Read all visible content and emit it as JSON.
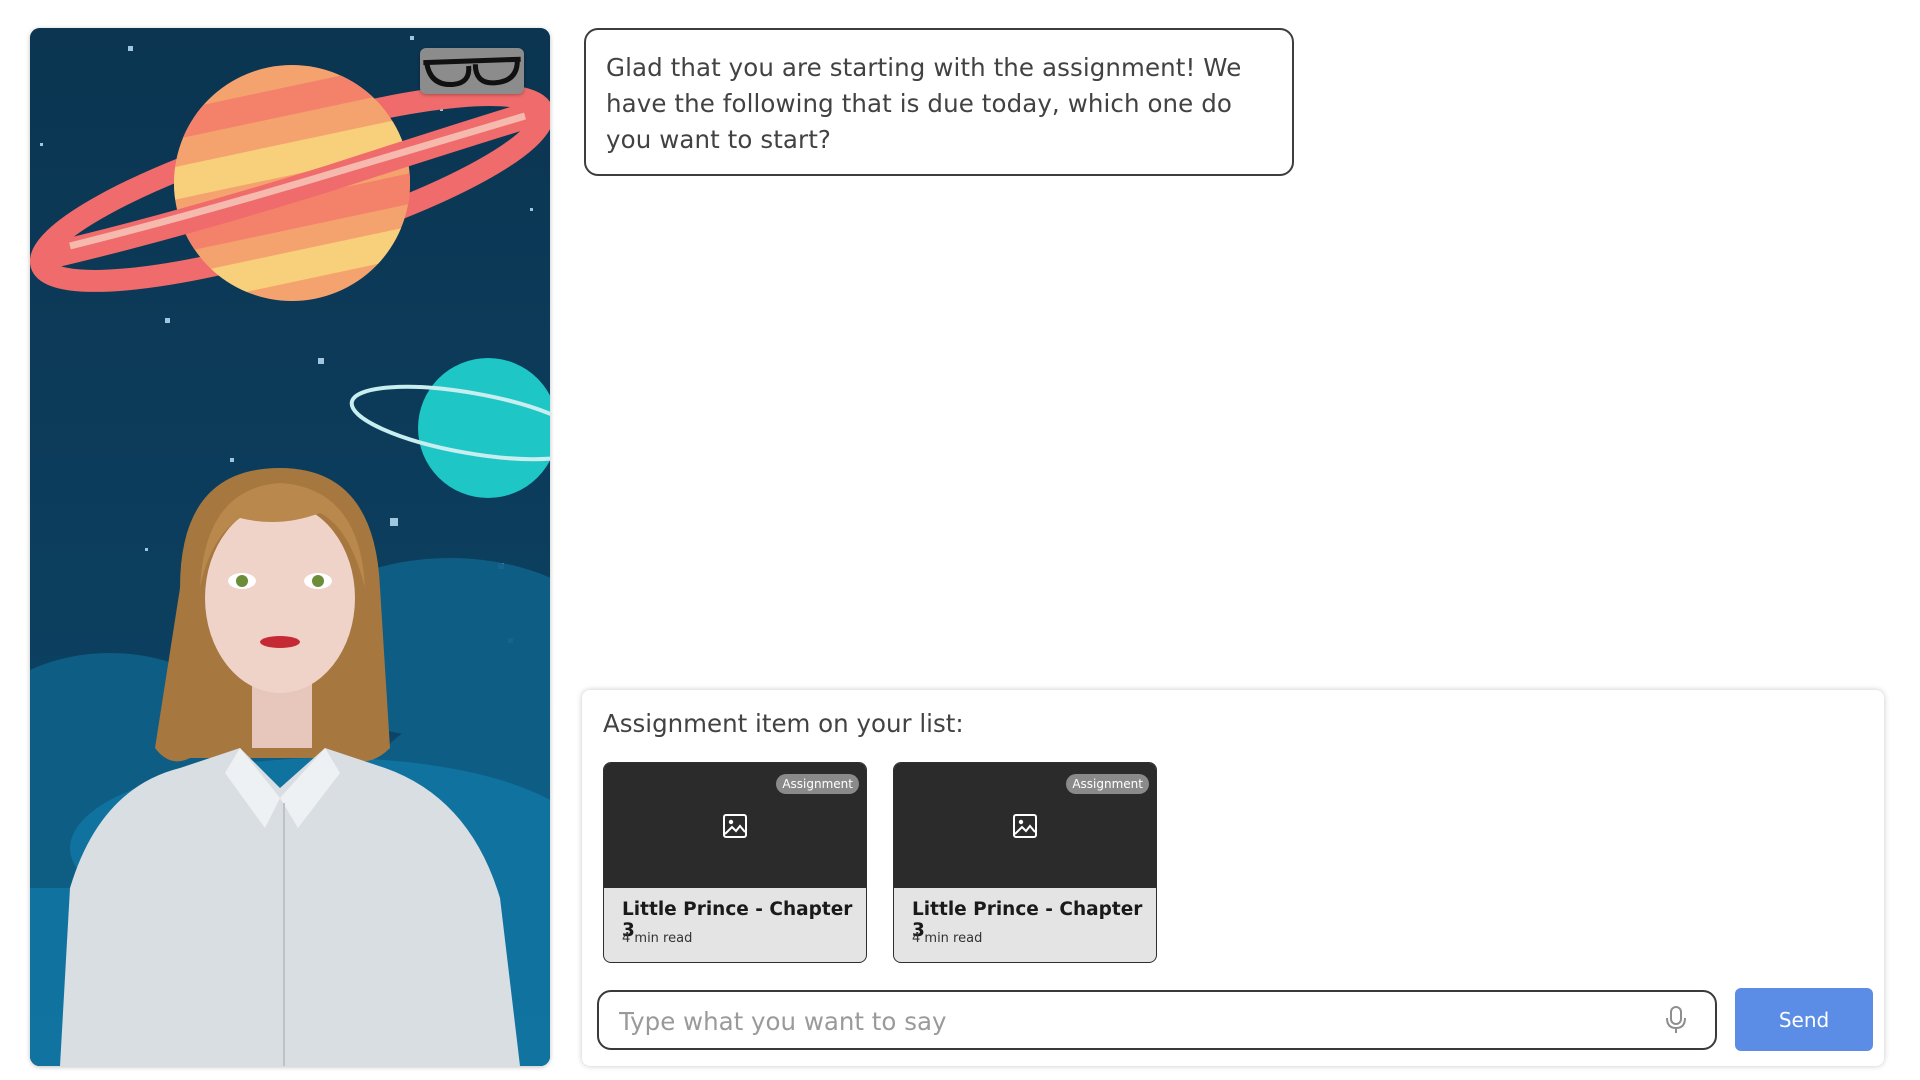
{
  "assistant": {
    "message": "Glad that you are starting with the assignment! We have the following that is due today, which one do you want to start?"
  },
  "avatar": {
    "toggle_icon": "glasses-icon"
  },
  "assignments": {
    "heading": "Assignment item on your list:",
    "items": [
      {
        "badge": "Assignment",
        "title": "Little Prince - Chapter 3",
        "meta": "4 min read",
        "thumb_icon": "image-icon"
      },
      {
        "badge": "Assignment",
        "title": "Little Prince - Chapter 3",
        "meta": "4 min read",
        "thumb_icon": "image-icon"
      }
    ]
  },
  "composer": {
    "placeholder": "Type what you want to say",
    "value": "",
    "mic_icon": "microphone-icon",
    "send_label": "Send"
  },
  "colors": {
    "send_button": "#5b8de6",
    "card_thumb": "#2b2b2b",
    "card_body": "#e4e4e4",
    "badge": "#8a8a8a",
    "space_background": "#0b3551"
  }
}
